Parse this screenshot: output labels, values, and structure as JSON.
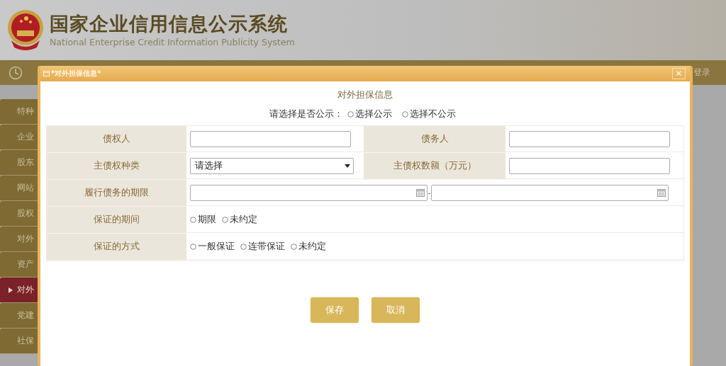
{
  "header": {
    "title": "国家企业信用信息公示系统",
    "subtitle": "National Enterprise Credit Information Publicity System"
  },
  "nav": {
    "login": "登录"
  },
  "sidebar": {
    "items": [
      {
        "label": "特种",
        "selected": false
      },
      {
        "label": "企业",
        "selected": false
      },
      {
        "label": "股东",
        "selected": false
      },
      {
        "label": "网站",
        "selected": false
      },
      {
        "label": "股权",
        "selected": false
      },
      {
        "label": "对外",
        "selected": false
      },
      {
        "label": "资产",
        "selected": false
      },
      {
        "label": "对外",
        "selected": true
      },
      {
        "label": "党建",
        "selected": false
      },
      {
        "label": "社保",
        "selected": false
      }
    ]
  },
  "dialog": {
    "title": "*对外担保信息*",
    "close": "×",
    "heading": "对外担保信息",
    "publicity": {
      "prompt": "请选择是否公示：",
      "options": [
        {
          "label": "选择公示",
          "selected": false
        },
        {
          "label": "选择不公示",
          "selected": false
        }
      ]
    },
    "rows": [
      {
        "cells": [
          {
            "label": "债权人",
            "kind": "text"
          },
          {
            "label": "债务人",
            "kind": "text"
          }
        ]
      },
      {
        "cells": [
          {
            "label": "主债权种类",
            "kind": "select",
            "value": "请选择"
          },
          {
            "label": "主债权数额（万元）",
            "kind": "text"
          }
        ]
      },
      {
        "cells": [
          {
            "label": "履行债务的期限",
            "kind": "daterange",
            "separator": "-"
          }
        ]
      },
      {
        "cells": [
          {
            "label": "保证的期间",
            "kind": "radio",
            "options": [
              {
                "label": "期限",
                "selected": false
              },
              {
                "label": "未约定",
                "selected": false
              }
            ]
          }
        ]
      },
      {
        "cells": [
          {
            "label": "保证的方式",
            "kind": "radio",
            "options": [
              {
                "label": "一般保证",
                "selected": false
              },
              {
                "label": "连带保证",
                "selected": false
              },
              {
                "label": "未约定",
                "selected": false
              }
            ]
          }
        ]
      }
    ],
    "buttons": [
      {
        "label": "保存"
      },
      {
        "label": "取消"
      }
    ]
  }
}
